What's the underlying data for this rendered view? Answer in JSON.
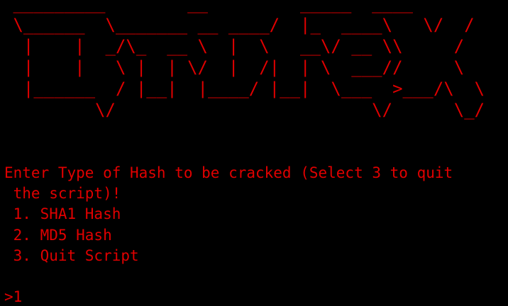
{
  "terminal": {
    "banner_art": " _________        __         _____  ____\n \\______  \\_______ __ ____/  |_  ____\\   \\/  /\n  |    |  _/\\_  __ \\  |  \\   __\\/ __ \\\\     /\n  |    |   \\ |  | \\/  |  /|  | \\  ___//     \\\n  |______  / |__|  |____/ |__|  \\___  >___/\\  \\\n         \\/                         \\/      \\_/",
    "banner_text": "BruteX",
    "prompt": "Enter Type of Hash to be cracked (Select 3 to quit",
    "prompt_continued": " the script)!",
    "options": [
      " 1. SHA1 Hash",
      " 2. MD5 Hash",
      " 3. Quit Script"
    ],
    "input_prompt": ">",
    "input_value": "1",
    "text_color": "#e00000",
    "background_color": "#000000"
  }
}
